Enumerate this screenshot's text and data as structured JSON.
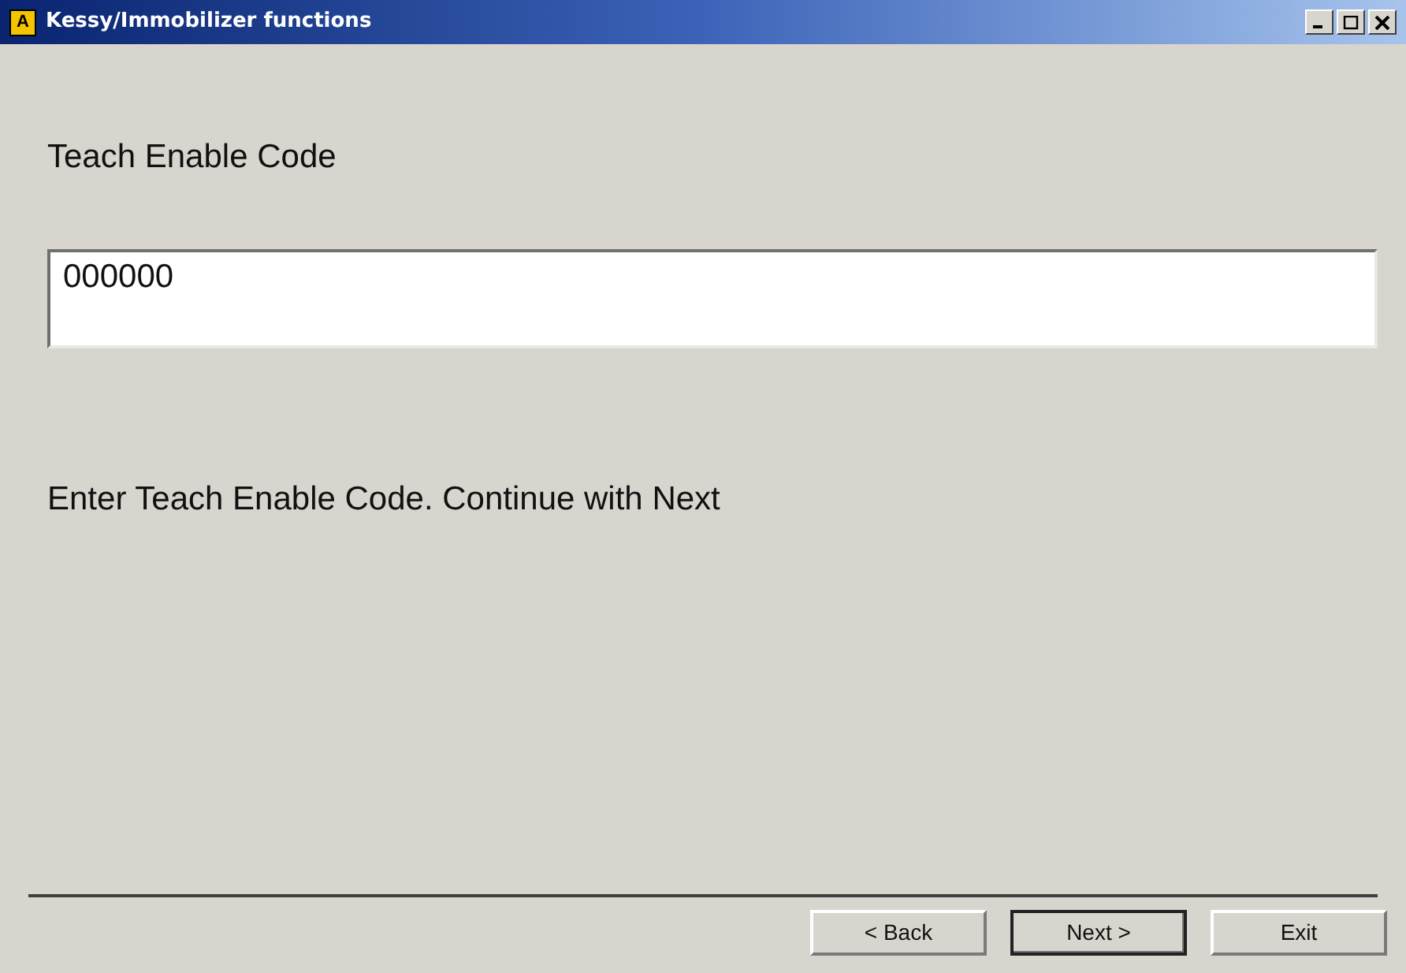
{
  "window": {
    "icon_letter": "A",
    "title": "Kessy/Immobilizer functions"
  },
  "heading": "Teach Enable Code",
  "code_field": {
    "value": "000000"
  },
  "message": "Enter Teach Enable Code. Continue with Next",
  "buttons": [
    {
      "label": "< Back",
      "default": false
    },
    {
      "label": "Next >",
      "default": true
    },
    {
      "label": "Exit",
      "default": false
    }
  ]
}
